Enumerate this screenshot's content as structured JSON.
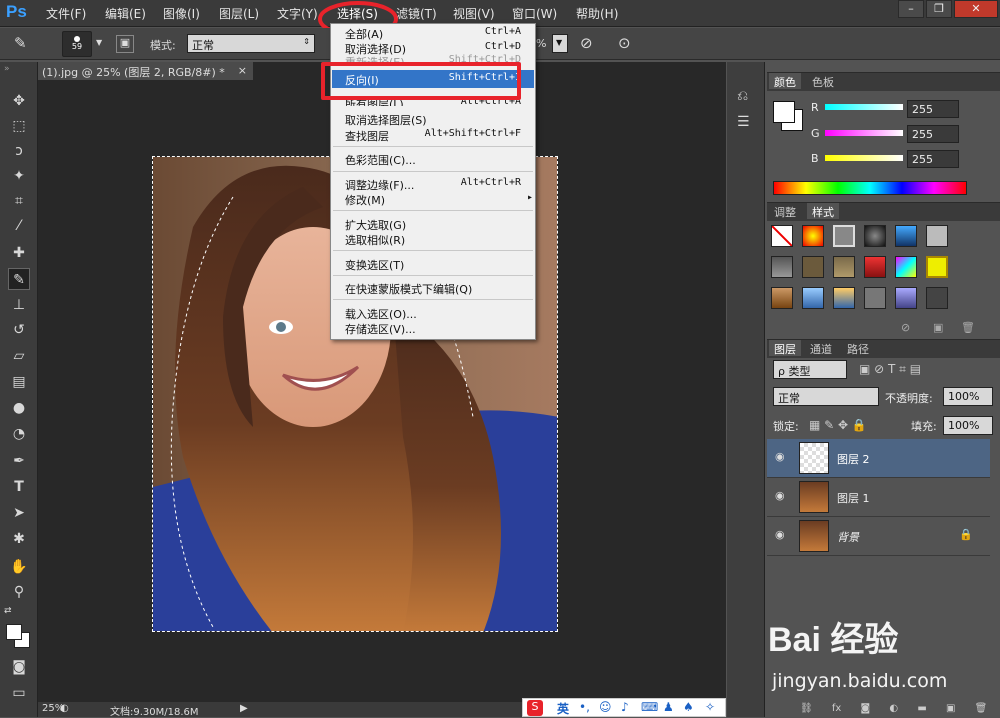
{
  "app": {
    "logo": "Ps"
  },
  "menubar": [
    "文件(F)",
    "编辑(E)",
    "图像(I)",
    "图层(L)",
    "文字(Y)",
    "选择(S)",
    "滤镜(T)",
    "视图(V)",
    "窗口(W)",
    "帮助(H)"
  ],
  "window_controls": [
    "–",
    "❐",
    "✕"
  ],
  "options": {
    "brush_size": "59",
    "mode_label": "模式:",
    "mode_value": "正常",
    "percent_tail": "%"
  },
  "document": {
    "tab_title": "(1).jpg @ 25% (图层 2, RGB/8#) *",
    "status_zoom": "25%",
    "status_doc": "文档:9.30M/18.6M"
  },
  "select_menu": {
    "items": [
      {
        "label": "全部(A)",
        "shortcut": "Ctrl+A"
      },
      {
        "label": "取消选择(D)",
        "shortcut": "Ctrl+D"
      },
      {
        "label": "重新选择(E)",
        "shortcut": "Shift+Ctrl+D"
      },
      {
        "label": "反向(I)",
        "shortcut": "Shift+Ctrl+I"
      },
      {
        "label": "所有图层(L)",
        "shortcut": "Alt+Ctrl+A"
      },
      {
        "label": "取消选择图层(S)",
        "shortcut": ""
      },
      {
        "label": "查找图层",
        "shortcut": "Alt+Shift+Ctrl+F"
      },
      {
        "label": "色彩范围(C)...",
        "shortcut": ""
      },
      {
        "label": "调整边缘(F)...",
        "shortcut": "Alt+Ctrl+R"
      },
      {
        "label": "修改(M)",
        "shortcut": "▸"
      },
      {
        "label": "扩大选取(G)",
        "shortcut": ""
      },
      {
        "label": "选取相似(R)",
        "shortcut": ""
      },
      {
        "label": "变换选区(T)",
        "shortcut": ""
      },
      {
        "label": "在快速蒙版模式下编辑(Q)",
        "shortcut": ""
      },
      {
        "label": "载入选区(O)...",
        "shortcut": ""
      },
      {
        "label": "存储选区(V)...",
        "shortcut": ""
      }
    ]
  },
  "color_panel": {
    "tabs": [
      "颜色",
      "色板"
    ],
    "channels": [
      {
        "name": "R",
        "value": "255",
        "color": "#00ffff"
      },
      {
        "name": "G",
        "value": "255",
        "color": "#ff00ff"
      },
      {
        "name": "B",
        "value": "255",
        "color": "#ffff00"
      }
    ]
  },
  "styles_panel": {
    "tabs": [
      "调整",
      "样式"
    ]
  },
  "layers_panel": {
    "tabs": [
      "图层",
      "通道",
      "路径"
    ],
    "filter_label": "ρ 类型",
    "blend_mode": "正常",
    "opacity_label": "不透明度:",
    "opacity_value": "100%",
    "lock_label": "锁定:",
    "fill_label": "填充:",
    "fill_value": "100%",
    "layers": [
      {
        "name": "图层 2",
        "selected": true
      },
      {
        "name": "图层 1",
        "selected": false
      },
      {
        "name": "背景",
        "selected": false
      }
    ]
  },
  "ime_bar": {
    "lang": "英"
  },
  "watermark": {
    "brand": "Bai 经验",
    "url": "jingyan.baidu.com"
  },
  "colors": {
    "highlight": "#3375c8",
    "annotation": "#e8232b"
  }
}
